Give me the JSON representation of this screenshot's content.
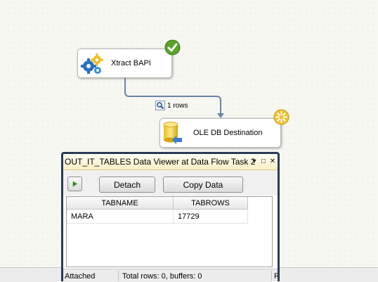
{
  "designer": {
    "nodes": [
      {
        "label": "Xtract BAPI",
        "icon": "gears-icon",
        "status": "success-check"
      },
      {
        "label": "OLE DB Destination",
        "icon": "database-cylinder-icon",
        "status": "in-progress"
      }
    ],
    "path": {
      "rows_label": "1 rows",
      "icon": "data-viewer-magnifier-icon"
    },
    "colors": {
      "path": "#6a86a8",
      "success": "#5aa22b",
      "progress": "#f0c230"
    }
  },
  "viewer": {
    "title": "OUT_IT_TABLES Data Viewer at Data Flow Task 2",
    "title_buttons": [
      "▾",
      "□",
      "✕"
    ],
    "toolbar": {
      "continue_icon": "play-icon",
      "detach_label": "Detach",
      "copy_label": "Copy Data"
    },
    "grid": {
      "columns": [
        "TABNAME",
        "TABROWS"
      ],
      "rows": [
        [
          "MARA",
          "17729"
        ]
      ]
    },
    "status": {
      "state": "Attached",
      "totals": "Total rows: 0, buffers: 0",
      "right": "R"
    }
  }
}
